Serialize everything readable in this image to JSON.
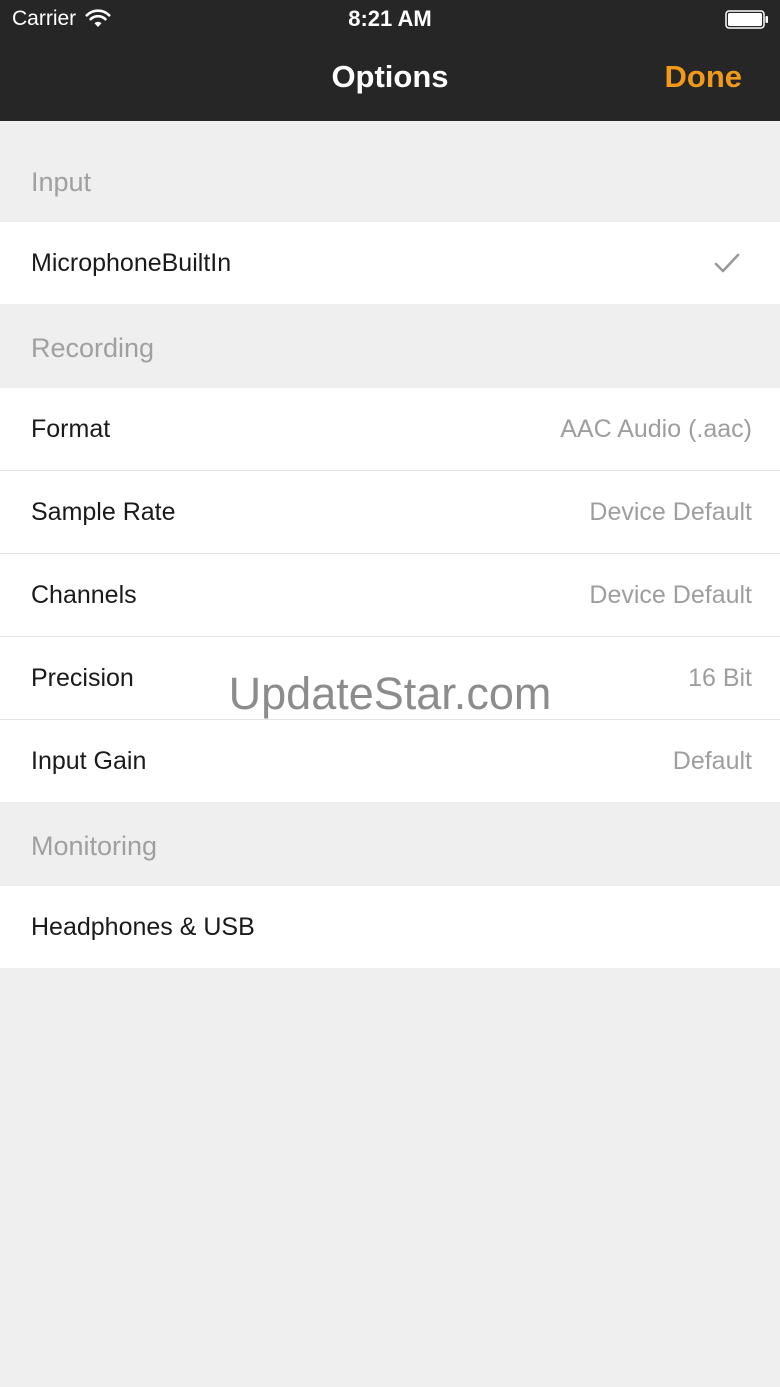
{
  "status_bar": {
    "carrier": "Carrier",
    "time": "8:21 AM",
    "wifi_icon": "wifi-icon",
    "battery_icon": "battery-icon"
  },
  "nav": {
    "title": "Options",
    "done_label": "Done",
    "done_color": "#f19a1a"
  },
  "sections": {
    "input": {
      "header": "Input",
      "items": [
        {
          "label": "MicrophoneBuiltIn",
          "selected": true,
          "icon": "checkmark-icon"
        }
      ]
    },
    "recording": {
      "header": "Recording",
      "items": [
        {
          "label": "Format",
          "value": "AAC Audio (.aac)"
        },
        {
          "label": "Sample Rate",
          "value": "Device Default"
        },
        {
          "label": "Channels",
          "value": "Device Default"
        },
        {
          "label": "Precision",
          "value": "16 Bit"
        },
        {
          "label": "Input Gain",
          "value": "Default"
        }
      ]
    },
    "monitoring": {
      "header": "Monitoring",
      "items": [
        {
          "label": "Headphones & USB"
        }
      ]
    }
  },
  "watermark": "UpdateStar.com"
}
